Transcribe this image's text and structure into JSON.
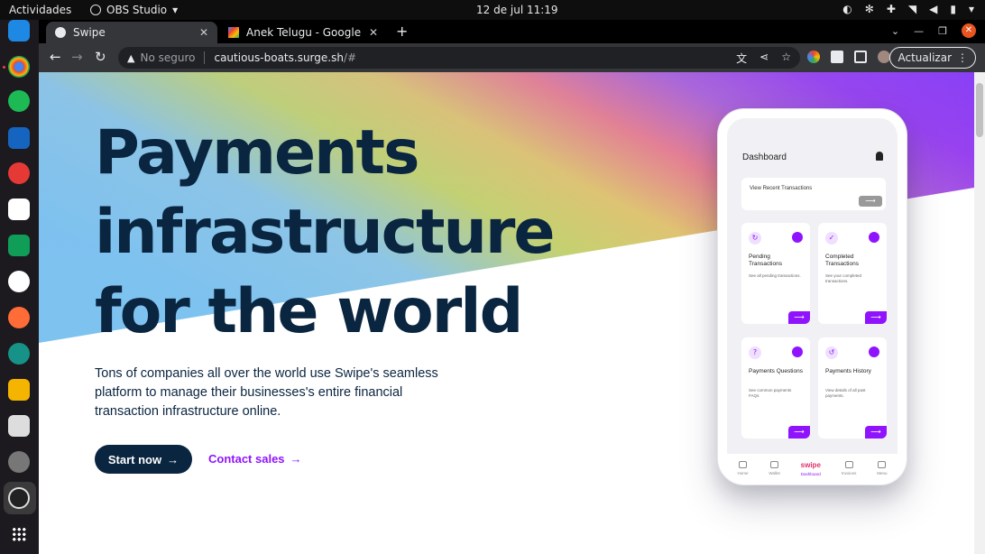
{
  "topbar": {
    "activities": "Actividades",
    "app_menu": "OBS Studio",
    "clock": "12 de jul  11:19"
  },
  "dock": {
    "apps": [
      "vscode-icon",
      "chrome-icon",
      "spotify-icon",
      "vscode-alt-icon",
      "youtube-music-icon",
      "notion-icon",
      "sheets-icon",
      "slack-icon",
      "postman-icon",
      "gitkraken-icon",
      "slides-icon",
      "screenshot-icon",
      "settings-icon",
      "obs-icon"
    ]
  },
  "browser": {
    "tabs": [
      {
        "title": "Swipe",
        "active": true
      },
      {
        "title": "Anek Telugu - Google Fon",
        "active": false
      }
    ],
    "omnibox": {
      "security": "No seguro",
      "url_host": "cautious-boats.surge.sh",
      "url_tail": "/#"
    },
    "update_label": "Actualizar"
  },
  "page": {
    "hero_title_lines": [
      "Payments",
      "infrastructure",
      "for the world"
    ],
    "hero_description": "Tons of companies all over the world use Swipe's seamless platform to manage their businesses's entire financial transaction infrastructure online.",
    "cta_primary": "Start now",
    "cta_secondary": "Contact sales",
    "arrow": "→"
  },
  "phone": {
    "header": "Dashboard",
    "recent_label": "View Recent Transactions",
    "cards": [
      {
        "title": "Pending Transactions",
        "desc": "See all pending transactions."
      },
      {
        "title": "Completed Transactions",
        "desc": "See your completed transactions."
      },
      {
        "title": "Payments Questions",
        "desc": "See common payments FAQs."
      },
      {
        "title": "Payments History",
        "desc": "View details of all past payments."
      }
    ],
    "tabbar": [
      "Home",
      "Wallet",
      "Dashboard",
      "Invoices",
      "Menu"
    ],
    "brand": "swipe"
  },
  "colors": {
    "navy": "#0a2540",
    "purple": "#9013fe"
  }
}
